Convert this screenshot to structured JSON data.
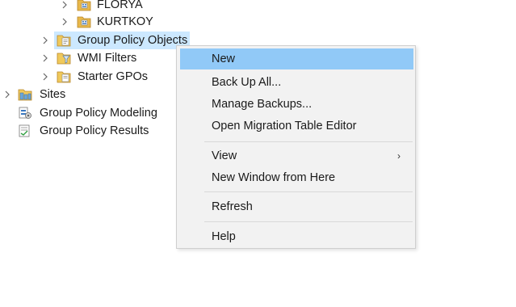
{
  "tree": {
    "nodes": [
      {
        "label": "FLORYA",
        "icon": "ou-folder-icon"
      },
      {
        "label": "KURTKOY",
        "icon": "ou-folder-icon"
      },
      {
        "label": "Group Policy Objects",
        "icon": "gpo-container-icon",
        "selected": true
      },
      {
        "label": "WMI Filters",
        "icon": "wmi-filters-icon"
      },
      {
        "label": "Starter GPOs",
        "icon": "starter-gpos-icon"
      },
      {
        "label": "Sites",
        "icon": "sites-icon"
      },
      {
        "label": "Group Policy Modeling",
        "icon": "gp-modeling-icon"
      },
      {
        "label": "Group Policy Results",
        "icon": "gp-results-icon"
      }
    ]
  },
  "context_menu": {
    "items": [
      {
        "label": "New",
        "highlighted": true
      },
      {
        "label": "Back Up All..."
      },
      {
        "label": "Manage Backups..."
      },
      {
        "label": "Open Migration Table Editor"
      },
      {
        "label": "View",
        "submenu": "›"
      },
      {
        "label": "New Window from Here"
      },
      {
        "label": "Refresh"
      },
      {
        "label": "Help"
      }
    ]
  },
  "colors": {
    "selection": "#cce8ff",
    "menu_highlight": "#91c9f7",
    "menu_background": "#f2f2f2"
  }
}
